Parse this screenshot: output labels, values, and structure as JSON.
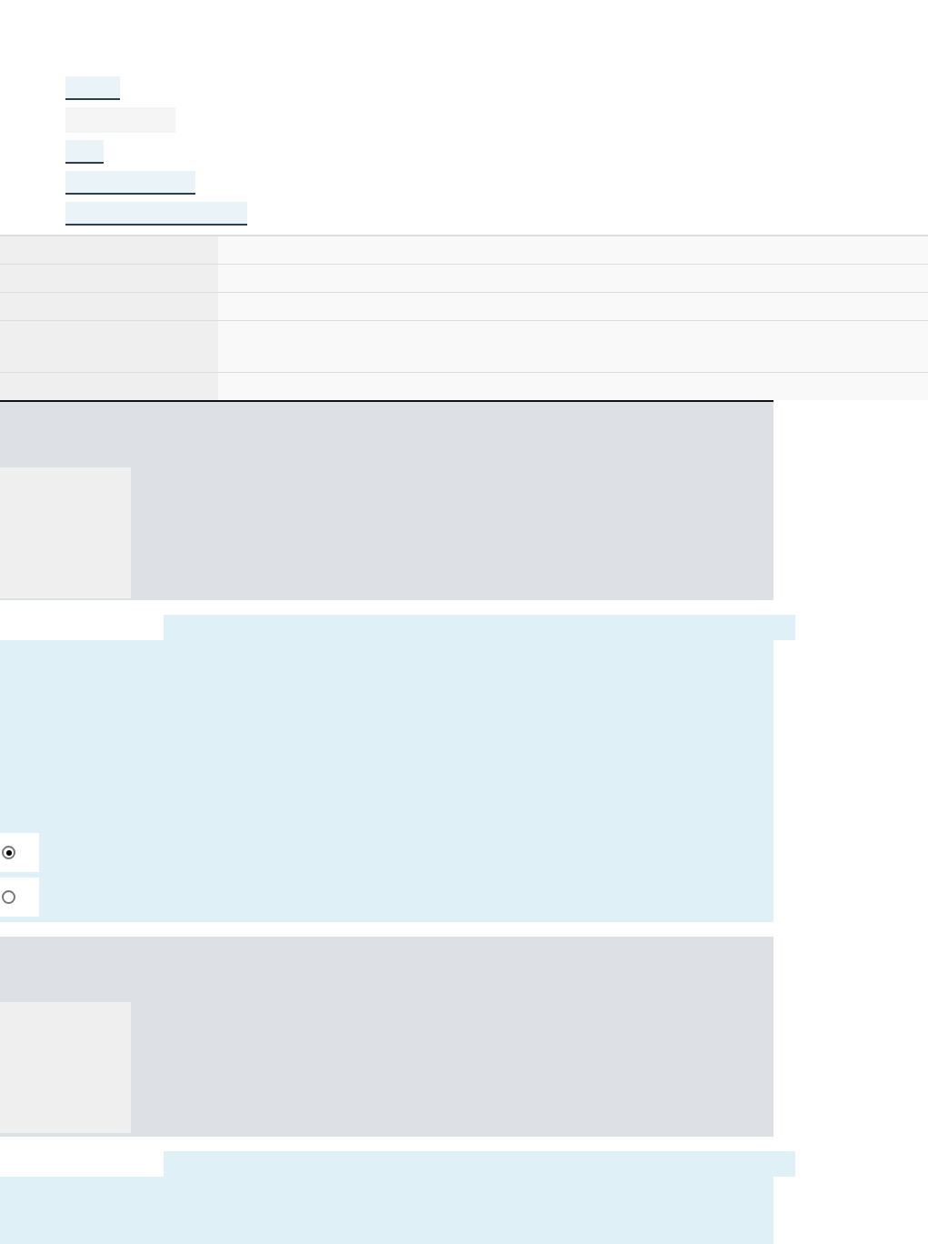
{
  "nav_links": [
    {
      "kind": "link"
    },
    {
      "kind": "plain"
    },
    {
      "kind": "link"
    },
    {
      "kind": "link"
    },
    {
      "kind": "link"
    }
  ],
  "questions": [
    {
      "radios": [
        {
          "selected": true
        },
        {
          "selected": false
        }
      ]
    }
  ]
}
